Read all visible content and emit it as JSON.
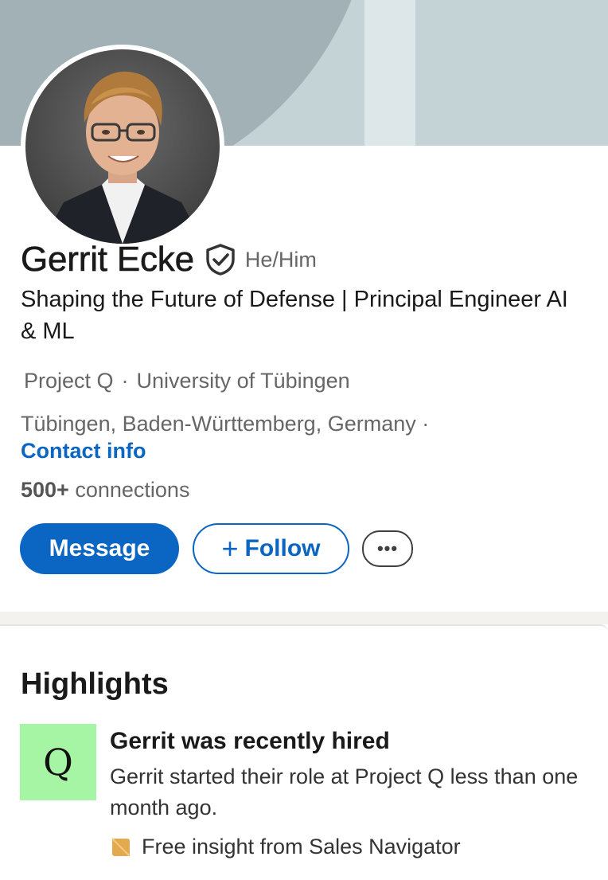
{
  "profile": {
    "name": "Gerrit Ecke",
    "pronouns": "He/Him",
    "headline": "Shaping the Future of Defense | Principal Engineer AI & ML",
    "current_company": "Project Q",
    "education": "University of Tübingen",
    "location": "Tübingen, Baden-Württemberg, Germany ·",
    "contact_info_label": "Contact info",
    "connections_count": "500+",
    "connections_label": "connections"
  },
  "actions": {
    "message_label": "Message",
    "follow_plus": "+",
    "follow_label": "Follow",
    "more_label": "•••"
  },
  "highlights": {
    "section_title": "Highlights",
    "company_logo_text": "Q",
    "item_title": "Gerrit was recently hired",
    "item_description": "Gerrit started their role at Project Q less than one month ago.",
    "insight_text": "Free insight from Sales Navigator"
  },
  "icons": {
    "verified": "verified-shield-icon",
    "more": "more-horizontal-icon",
    "insight": "sales-navigator-icon"
  },
  "colors": {
    "brand_blue": "#0a66c2",
    "banner": "#c4d3d6",
    "banner_arc": "#a2b1b5",
    "logo_green": "#a6f5a4",
    "insight_orange": "#e3a94f"
  }
}
